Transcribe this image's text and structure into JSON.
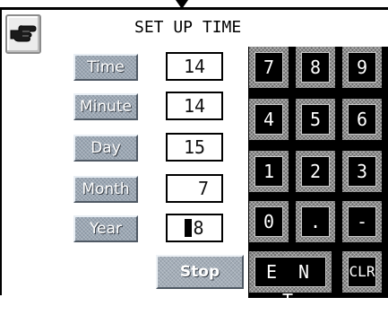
{
  "screen": {
    "title": "SET UP TIME"
  },
  "icons": {
    "back": "hand-pointer-icon",
    "top_marker": "down-triangle-icon"
  },
  "fields": [
    {
      "label": "Time",
      "value": "14"
    },
    {
      "label": "Minute",
      "value": "14"
    },
    {
      "label": "Day",
      "value": "15"
    },
    {
      "label": "Month",
      "value": "7"
    },
    {
      "label": "Year",
      "value": "8"
    }
  ],
  "keypad": {
    "keys": [
      "7",
      "8",
      "9",
      "4",
      "5",
      "6",
      "1",
      "2",
      "3",
      "0",
      ".",
      "-"
    ],
    "enter_label": "E N T",
    "clear_label": "CLR"
  },
  "stop_label": "Stop",
  "colors": {
    "label_button": "#9aa6b3",
    "keypad_bg": "#000000",
    "key_text": "#ffffff"
  }
}
